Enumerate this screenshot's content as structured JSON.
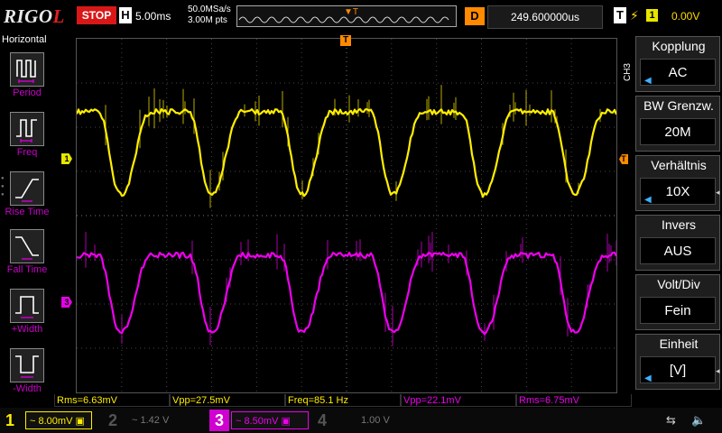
{
  "header": {
    "brand_main": "RIGO",
    "brand_tail": "L",
    "run_state": "STOP",
    "horizontal_badge": "H",
    "timebase": "5.00ms",
    "sample_rate": "50.0MSa/s",
    "memory_points": "3.00M pts",
    "trigger_marker": "T",
    "delay_badge": "D",
    "delay_value": "249.600000us",
    "trigger_badge": "T",
    "trigger_source": "1",
    "trigger_level": "0.00V"
  },
  "left_menu": {
    "title": "Horizontal",
    "items": [
      {
        "label": "Period",
        "icon": "period-icon"
      },
      {
        "label": "Freq",
        "icon": "frequency-icon"
      },
      {
        "label": "Rise Time",
        "icon": "rise-time-icon"
      },
      {
        "label": "Fall Time",
        "icon": "fall-time-icon"
      },
      {
        "label": "+Width",
        "icon": "positive-width-icon"
      },
      {
        "label": "-Width",
        "icon": "negative-width-icon"
      }
    ]
  },
  "right_menu": {
    "channel_tag": "CH3",
    "items": [
      {
        "title": "Kopplung",
        "value": "AC"
      },
      {
        "title": "BW Grenzw.",
        "value": "20M"
      },
      {
        "title": "Verhältnis",
        "value": "10X"
      },
      {
        "title": "Invers",
        "value": "AUS"
      },
      {
        "title": "Volt/Div",
        "value": "Fein"
      },
      {
        "title": "Einheit",
        "value": "[V]"
      }
    ]
  },
  "markers": {
    "ch1": "1",
    "ch3": "3",
    "trigger": "T"
  },
  "measurements": [
    {
      "text": "Rms=6.63mV",
      "channel": 1
    },
    {
      "text": "Vpp=27.5mV",
      "channel": 1
    },
    {
      "text": "Freq=85.1 Hz",
      "channel": 1
    },
    {
      "text": "Vpp=22.1mV",
      "channel": 3
    },
    {
      "text": "Rms=6.75mV",
      "channel": 3
    }
  ],
  "channels": [
    {
      "num": "1",
      "scale": "8.00mV",
      "coupling": "~",
      "active": true
    },
    {
      "num": "2",
      "scale": "1.42 V",
      "coupling": "~",
      "active": false
    },
    {
      "num": "3",
      "scale": "8.50mV",
      "coupling": "~",
      "active": true
    },
    {
      "num": "4",
      "scale": "1.00 V",
      "coupling": "",
      "active": false
    }
  ],
  "colors": {
    "ch1": "#ffee00",
    "ch3": "#ee00ee",
    "trigger": "#ff8a00",
    "stop": "#d81818",
    "selection": "#3fb0ff"
  }
}
